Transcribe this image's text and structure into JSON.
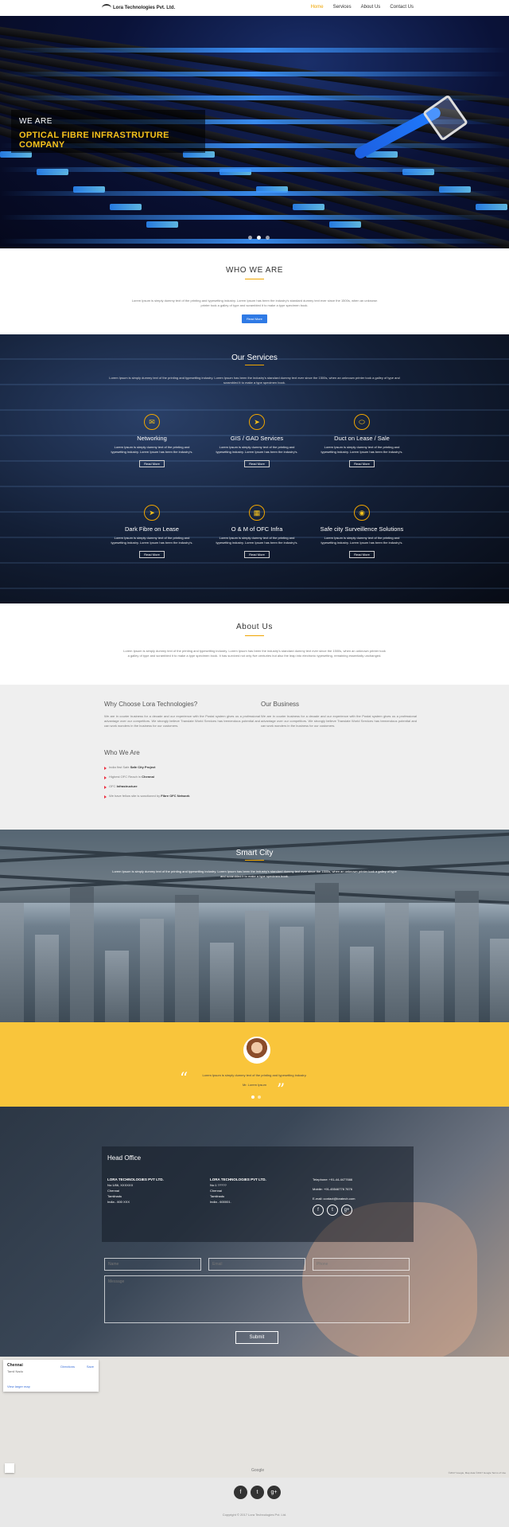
{
  "nav": {
    "logo": "Lora Technologies Pvt. Ltd.",
    "links": [
      "Home",
      "Services",
      "About Us",
      "Contact Us"
    ],
    "active_index": 0
  },
  "hero": {
    "line1": "WE ARE",
    "line2": "OPTICAL FIBRE INFRASTRUTURE COMPANY",
    "slide_count": 3,
    "active_slide": 1
  },
  "who": {
    "title": "WHO WE ARE",
    "text": "Lorem Ipsum is simply dummy text of the printing and typesetting industry. Lorem Ipsum has been the industry's standard dummy text ever since the 1500s, when an unknown printer took a galley of type and scrambled it to make a type specimen book.",
    "button": "Read More"
  },
  "services": {
    "title": "Our Services",
    "intro": "Lorem Ipsum is simply dummy text of the printing and typesetting industry. Lorem Ipsum has been the industry's standard dummy text ever since the 1500s, when an unknown printer took a galley of type and scrambled it to make a type specimen book.",
    "items": [
      {
        "name": "Networking",
        "icon": "envelope-icon",
        "glyph": "✉",
        "desc": "Lorem Ipsum is simply dummy text of the printing and typesetting industry. Lorem Ipsum has been the industry's.",
        "button": "Read More"
      },
      {
        "name": "GIS / GAD Services",
        "icon": "paper-plane-icon",
        "glyph": "➤",
        "desc": "Lorem Ipsum is simply dummy text of the printing and typesetting industry. Lorem Ipsum has been the industry's.",
        "button": "Read More"
      },
      {
        "name": "Duct on Lease / Sale",
        "icon": "pill-icon",
        "glyph": "⬭",
        "desc": "Lorem Ipsum is simply dummy text of the printing and typesetting industry. Lorem Ipsum has been the industry's.",
        "button": "Read More"
      },
      {
        "name": "Dark Fibre on Lease",
        "icon": "paper-plane-icon",
        "glyph": "➤",
        "desc": "Lorem Ipsum is simply dummy text of the printing and typesetting industry. Lorem Ipsum has been the industry's.",
        "button": "Read More"
      },
      {
        "name": "O & M of OFC Infra",
        "icon": "building-icon",
        "glyph": "▦",
        "desc": "Lorem Ipsum is simply dummy text of the printing and typesetting industry. Lorem Ipsum has been the industry's.",
        "button": "Read More"
      },
      {
        "name": "Safe city Surveillence Solutions",
        "icon": "eye-icon",
        "glyph": "◉",
        "desc": "Lorem Ipsum is simply dummy text of the printing and typesetting industry. Lorem Ipsum has been the industry's.",
        "button": "Read More"
      }
    ]
  },
  "about": {
    "title": "About Us",
    "text": "Lorem Ipsum is simply dummy text of the printing and typesetting industry. Lorem Ipsum has been the industry's standard dummy text ever since the 1500s, when an unknown printer took a galley of type and scrambled it to make a type specimen book. It has survived not only five centuries but also the leap into electronic typesetting, remaining essentially unchanged."
  },
  "why": {
    "title": "Why Choose Lora Technologies?",
    "text": "We are in courier business for a decade and our experience with the Postal system gives us a professional advantage over our competitors. We strongly believe Translate World Services has tremendous potential and can work wonders in the business for our customers.",
    "business_title": "Our Business",
    "business_text": "We are in courier business for a decade and our experience with the Postal system gives us a professional advantage over our competitors. We strongly believe Translate World Services has tremendous potential and can work wonders in the business for our customers.",
    "whoweare_title": "Who We Are",
    "list": [
      {
        "pre": "India first Safe ",
        "bold": "Safe City Project"
      },
      {
        "pre": "Highest OFC Reach in ",
        "bold": "Chennai"
      },
      {
        "pre": "OFC ",
        "bold": "Infrastructure"
      },
      {
        "pre": "We have fellow site is sanctioned by ",
        "bold": "Fibre OFC Network"
      }
    ]
  },
  "smart": {
    "title": "Smart City",
    "text": "Lorem Ipsum is simply dummy text of the printing and typesetting industry. Lorem Ipsum has been the industry's standard dummy text ever since the 1500s, when an unknown printer took a galley of type and scrambled it to make a type specimen book."
  },
  "testimonial": {
    "text": "Lorem Ipsum is simply dummy text of the printing and typesetting industry.",
    "name": "Mr. Lorem Ipsum",
    "dots": 2,
    "active": 0
  },
  "contact": {
    "title": "Head Office",
    "addr1": {
      "company": "LORA TECHNOLOGIES PVT LTD.",
      "lines": [
        "No:1/86, XXXXXX",
        "Chennai",
        "Tamilnadu",
        "India - 600 XXX"
      ]
    },
    "addr2": {
      "company": "LORA TECHNOLOGIES PVT LTD.",
      "lines": [
        "No:1 ?????",
        "Chennai",
        "Tamilnadu",
        "India - 600001."
      ]
    },
    "phone": "Telephone: +91-44-4477666",
    "mobile": "Mobile: +91-45546776 7676",
    "email": "E-mail: contact@loratech.com",
    "name_ph": "Name",
    "email_ph": "Email",
    "phone_ph": "Phone",
    "message_ph": "Message",
    "submit": "Submit"
  },
  "map": {
    "place": "Chennai",
    "sub": "Tamil Nadu",
    "link": "View larger map",
    "directions": "Directions",
    "save": "Save",
    "google": "Google",
    "terms": "©2017 Google, Map data ©2017 Google  Terms of Use"
  },
  "footer": {
    "copy": "Copyright © 2017 Lora Technologies Pvt. Ltd."
  }
}
